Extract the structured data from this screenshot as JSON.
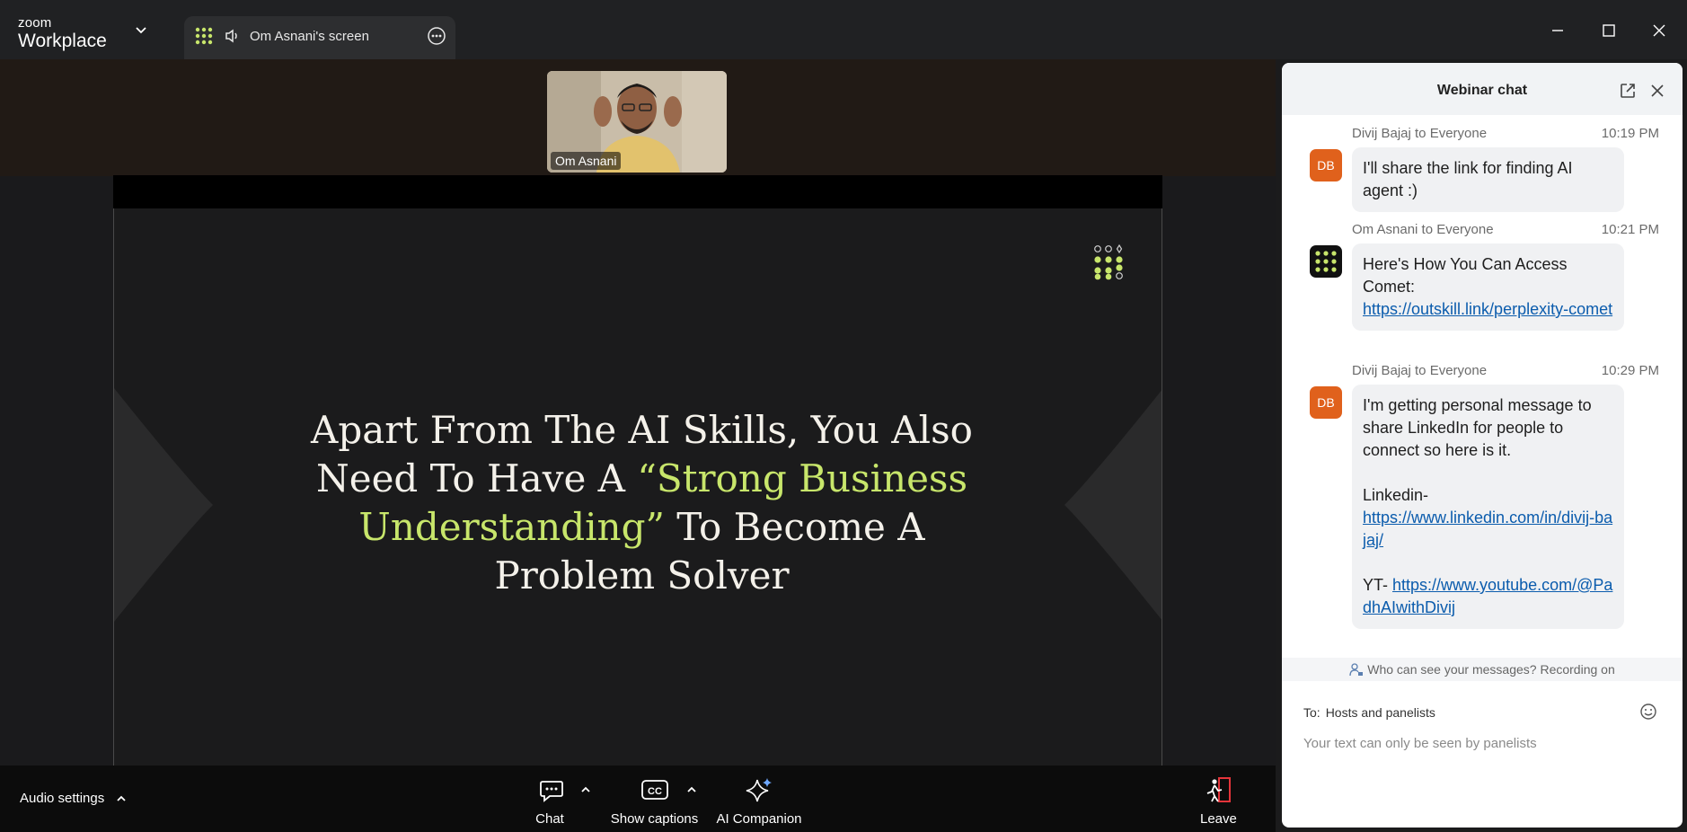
{
  "app": {
    "brand_small": "zoom",
    "brand_big": "Workplace"
  },
  "tab": {
    "label": "Om Asnani's screen"
  },
  "video": {
    "participant_name": "Om Asnani"
  },
  "slide": {
    "line1": "Apart From The AI Skills, You Also",
    "line2_pre": "Need To Have A ",
    "line2_highlight": "“Strong Business",
    "line3_highlight": "Understanding”",
    "line3_post": " To Become A",
    "line4": "Problem Solver",
    "highlight_color": "#c8e66b"
  },
  "toolbar": {
    "audio_settings": "Audio settings",
    "chat": "Chat",
    "show_captions": "Show captions",
    "ai_companion": "AI Companion",
    "leave": "Leave"
  },
  "chat": {
    "title": "Webinar chat",
    "messages": [
      {
        "sender": "Divij Bajaj to Everyone",
        "time": "10:19 PM",
        "initials": "DB",
        "text": "I'll share the link for finding AI agent :)"
      },
      {
        "sender": "Om Asnani to Everyone",
        "time": "10:21 PM",
        "text": "Here's How You Can Access Comet:",
        "link": "https://outskill.link/perplexity-comet"
      },
      {
        "sender": "Divij Bajaj to Everyone",
        "time": "10:29 PM",
        "initials": "DB",
        "text": "I'm getting personal message to share LinkedIn for people to connect so here is it.",
        "linkedin_label": "Linkedin-",
        "linkedin_link": "https://www.linkedin.com/in/divij-bajaj/",
        "yt_label": "YT- ",
        "yt_link": "https://www.youtube.com/@PadhAIwithDivij"
      }
    ],
    "privacy": "Who can see your messages? Recording on",
    "to_label": "To:",
    "to_value": "Hosts and panelists",
    "placeholder": "Your text can only be seen by panelists"
  },
  "colors": {
    "avatar_db": "#e0611c",
    "link": "#0b5cad",
    "leave_red": "#e5343a"
  },
  "icons": {
    "apps": "apps-grid-icon",
    "speaker": "speaker-icon",
    "more": "more-icon",
    "chat": "chat-icon",
    "captions": "cc-icon",
    "ai": "sparkle-icon",
    "leave": "leave-door-icon"
  }
}
